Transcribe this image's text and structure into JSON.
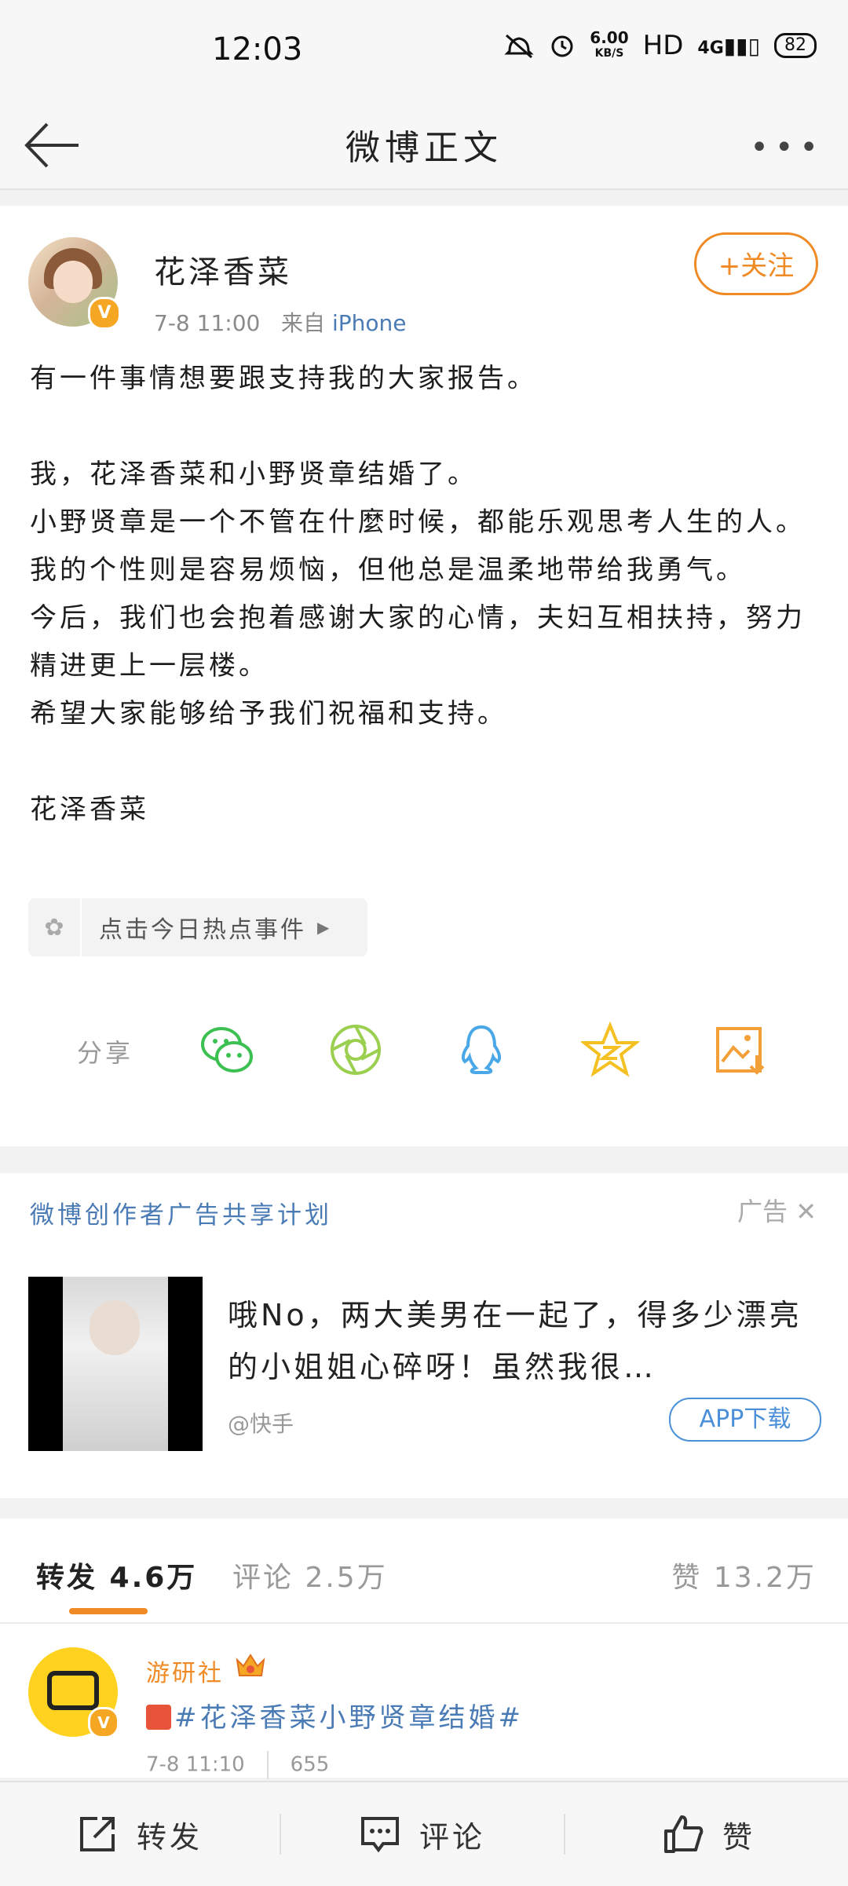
{
  "status_bar": {
    "time": "12:03",
    "net_speed_value": "6.00",
    "net_speed_unit": "KB/S",
    "hd": "HD",
    "network": "4G",
    "battery": "82"
  },
  "nav": {
    "title": "微博正文",
    "more": "•••"
  },
  "post": {
    "author": "花泽香菜",
    "timestamp": "7-8 11:00",
    "from_label": "来自",
    "source": "iPhone",
    "follow_label": "+关注",
    "paragraphs": [
      "有一件事情想要跟支持我的大家报告。",
      "",
      "我，花泽香菜和小野贤章结婚了。",
      "小野贤章是一个不管在什麼时候，都能乐观思考人生的人。",
      "我的个性则是容易烦恼，但他总是温柔地带给我勇气。",
      "今后，我们也会抱着感谢大家的心情，夫妇互相扶持，努力精进更上一层楼。",
      "希望大家能够给予我们祝福和支持。",
      "",
      "花泽香菜"
    ],
    "topic_label": "点击今日热点事件"
  },
  "share": {
    "label": "分享",
    "targets": [
      "wechat-icon",
      "moments-icon",
      "qq-icon",
      "qzone-icon",
      "save-image-icon"
    ]
  },
  "ad": {
    "title": "微博创作者广告共享计划",
    "label": "广告",
    "text": "哦No，两大美男在一起了，得多少漂亮的小姐姐心碎呀！虽然我很…",
    "source": "@快手",
    "button": "APP下载"
  },
  "stats": {
    "repost": "转发 4.6万",
    "comment": "评论 2.5万",
    "like": "赞 13.2万"
  },
  "repost_item": {
    "user": "游研社",
    "text": "#花泽香菜小野贤章结婚#",
    "time": "7-8 11:10",
    "count": "655"
  },
  "bottom_bar": {
    "repost": "转发",
    "comment": "评论",
    "like": "赞"
  },
  "colors": {
    "accent": "#f08a24",
    "link": "#4a7bb5",
    "vip": "#f5a623"
  }
}
